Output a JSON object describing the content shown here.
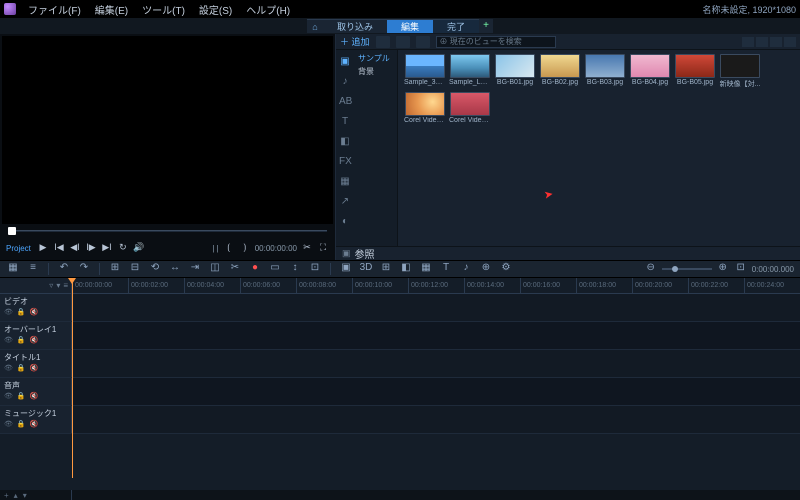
{
  "menu": {
    "file": "ファイル(F)",
    "edit": "編集(E)",
    "tool": "ツール(T)",
    "settings": "設定(S)",
    "help": "ヘルプ(H)"
  },
  "project_info": "名称未設定, 1920*1080",
  "tabs": {
    "capture": "取り込み",
    "edit": "編集",
    "done": "完了"
  },
  "preview": {
    "mode": "Project",
    "timecode": "00:00:00:00",
    "tc_marks": "|    |"
  },
  "library": {
    "add": "＋ 追加",
    "search_placeholder": "⊕ 現在のビューを検索",
    "tree": {
      "sample": "サンプル",
      "bg": "背景"
    },
    "thumbs": [
      {
        "label": "Sample_360...",
        "cls": "g-sky"
      },
      {
        "label": "Sample_Lak...",
        "cls": "g-lake"
      },
      {
        "label": "BG-B01.jpg",
        "cls": "g-b01"
      },
      {
        "label": "BG-B02.jpg",
        "cls": "g-b02"
      },
      {
        "label": "BG-B03.jpg",
        "cls": "g-b03"
      },
      {
        "label": "BG-B04.jpg",
        "cls": "g-b04"
      },
      {
        "label": "BG-B05.jpg",
        "cls": "g-b05"
      },
      {
        "label": "新映像【対...",
        "cls": "g-new"
      },
      {
        "label": "Corel Video...",
        "cls": "g-corel"
      },
      {
        "label": "Corel Video...",
        "cls": "g-cv"
      }
    ],
    "footer": "参照"
  },
  "timeline": {
    "ticks": [
      "00:00:00:00",
      "00:00:02:00",
      "00:00:04:00",
      "00:00:06:00",
      "00:00:08:00",
      "00:00:10:00",
      "00:00:12:00",
      "00:00:14:00",
      "00:00:16:00",
      "00:00:18:00",
      "00:00:20:00",
      "00:00:22:00",
      "00:00:24:00"
    ],
    "tracks": [
      {
        "name": "ビデオ"
      },
      {
        "name": "オーバーレイ1"
      },
      {
        "name": "タイトル1"
      },
      {
        "name": "音声"
      },
      {
        "name": "ミュージック1"
      }
    ],
    "zoom_tc": "0:00:00.000"
  }
}
